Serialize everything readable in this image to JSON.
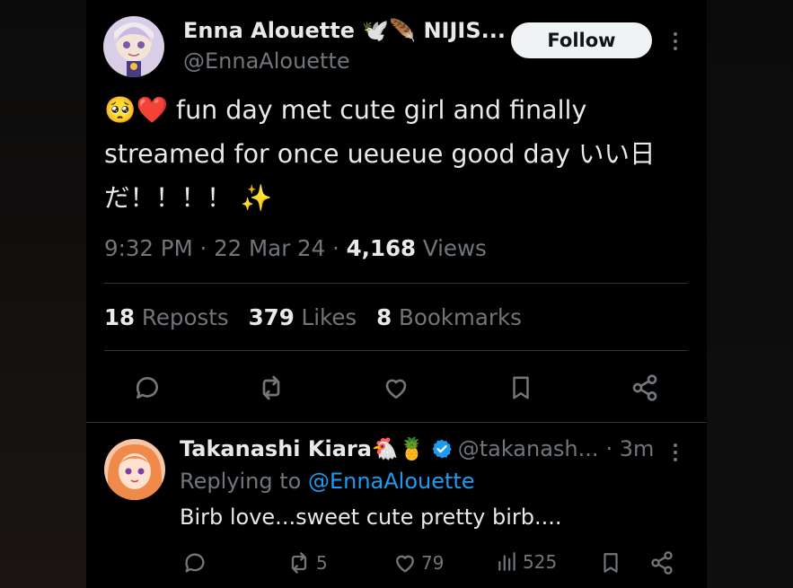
{
  "tweet": {
    "author_name": "Enna Alouette 🕊️🪶 NIJIS...",
    "author_handle": "@EnnaAlouette",
    "follow_label": "Follow",
    "text": "🥺❤️ fun day met cute girl and finally\nstreamed for once ueueue good day いい日\nだ！！！！ ✨",
    "time": "9:32 PM · 22 Mar 24 · ",
    "views_count": "4,168",
    "views_label": " Views",
    "reposts_count": "18",
    "reposts_label": "Reposts",
    "likes_count": "379",
    "likes_label": "Likes",
    "bookmarks_count": "8",
    "bookmarks_label": "Bookmarks"
  },
  "reply": {
    "author_name": "Takanashi Kiara🐔🍍",
    "author_handle": "@takanash...",
    "time": "· 3m",
    "replying_prefix": "Replying to ",
    "replying_handle": "@EnnaAlouette",
    "text": "Birb love...sweet cute pretty birb....",
    "retweets": "5",
    "likes": "79",
    "views": "525"
  },
  "icons": {
    "reply": "comment-icon",
    "retweet": "repost-icon",
    "like": "heart-icon",
    "bookmark": "bookmark-icon",
    "share": "share-icon",
    "more": "more-dots-icon",
    "verified": "verified-badge-icon",
    "views": "analytics-icon"
  },
  "colors": {
    "background": "#000000",
    "text": "#e7e9ea",
    "muted": "#71767b",
    "link": "#1d9bf0",
    "follow_bg": "#eff3f4"
  }
}
